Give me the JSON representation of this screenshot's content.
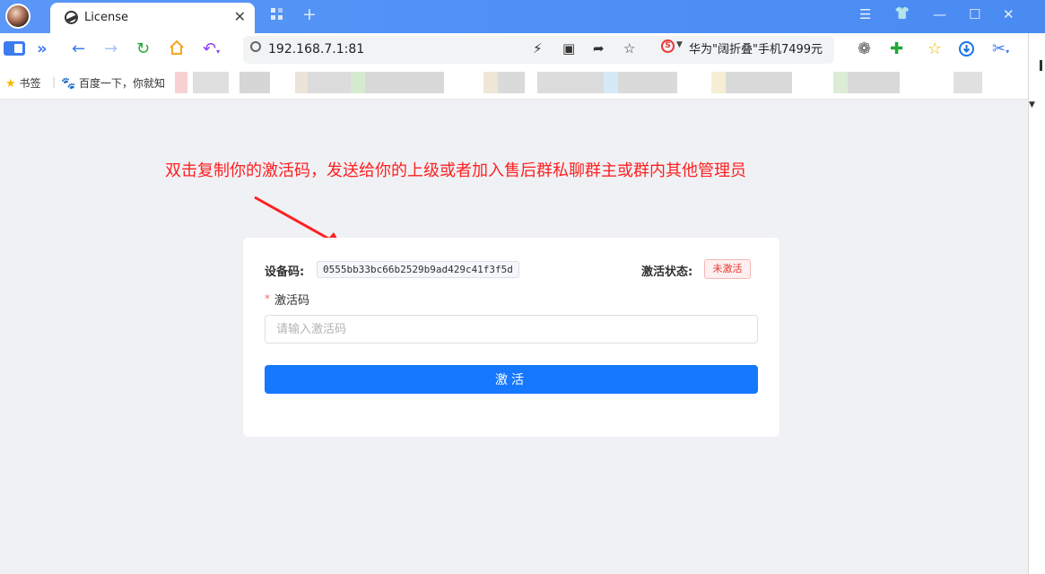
{
  "browser": {
    "tab": {
      "title": "License",
      "close": "✕"
    },
    "tabstrip_icons": {
      "new_tab": "+"
    },
    "window_controls": {
      "menu": "☰",
      "skin": "👕",
      "minimize": "—",
      "maximize": "☐",
      "close": "✕"
    },
    "nav": {
      "address": "192.168.7.1:81",
      "search_text": "华为\"阔折叠\"手机7499元"
    },
    "bookmarks": [
      {
        "label": "书签"
      },
      {
        "label": "百度一下，你就知"
      }
    ]
  },
  "page": {
    "annotation": "双击复制你的激活码，发送给你的上级或者加入售后群私聊群主或群内其他管理员",
    "device_label": "设备码:",
    "device_code": "0555bb33bc66b2529b9ad429c41f3f5d",
    "status_label": "激活状态:",
    "status_value": "未激活",
    "required_mark": "*",
    "code_label": "激活码",
    "code_placeholder": "请输入激活码",
    "code_value": "",
    "activate_label": "激活"
  },
  "colors": {
    "tabstrip": "#4e8ff5",
    "annotation": "#ff1f1f",
    "primary_button": "#1677ff",
    "status_text": "#e53935",
    "page_background": "#f0f1f5"
  }
}
